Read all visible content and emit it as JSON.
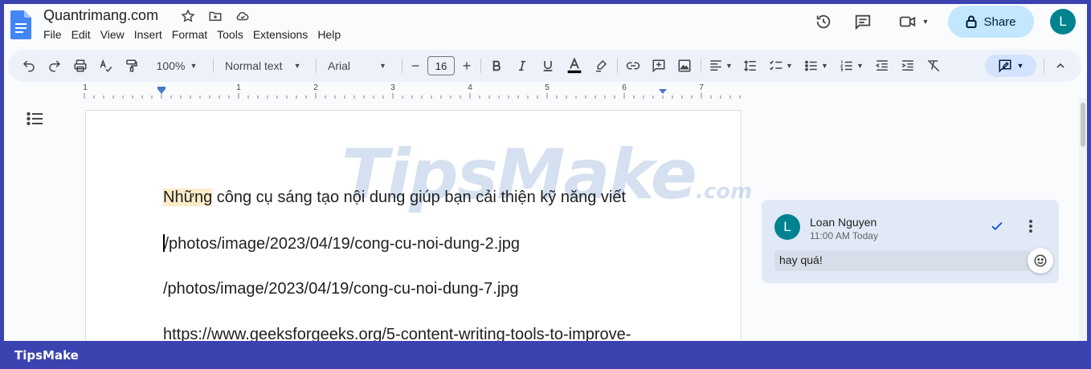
{
  "app": {
    "doc_title": "Quantrimang.com",
    "menu": [
      "File",
      "Edit",
      "View",
      "Insert",
      "Format",
      "Tools",
      "Extensions",
      "Help"
    ],
    "share_label": "Share",
    "user_initial": "L"
  },
  "toolbar": {
    "zoom": "100%",
    "style": "Normal text",
    "font": "Arial",
    "font_size": "16",
    "minus": "−",
    "plus": "+"
  },
  "ruler": {
    "numbers": [
      "1",
      "1",
      "2",
      "3",
      "4",
      "5",
      "6",
      "7"
    ]
  },
  "document": {
    "lines": [
      {
        "highlight": "Những",
        "rest": " công cụ sáng tạo nội dung giúp bạn cải thiện kỹ năng viết"
      },
      {
        "text": "/photos/image/2023/04/19/cong-cu-noi-dung-2.jpg"
      },
      {
        "text": "/photos/image/2023/04/19/cong-cu-noi-dung-7.jpg"
      },
      {
        "text": "https://www.geeksforgeeks.org/5-content-writing-tools-to-improve-"
      }
    ]
  },
  "watermark": {
    "main": "TipsMake",
    "suffix": ".com"
  },
  "comment": {
    "author_initial": "L",
    "author": "Loan Nguyen",
    "time": "11:00 AM Today",
    "reply_text": "hay quá!"
  },
  "brand": "TipsMake",
  "colors": {
    "frame": "#3b43b0",
    "accent": "#0b57d0",
    "avatar": "#00838f",
    "share_bg": "#c2e7ff",
    "highlight": "#fdecc8"
  },
  "icons": [
    "docs-icon",
    "star-icon",
    "folder-icon",
    "cloud-icon",
    "history-icon",
    "comment-icon",
    "video-icon",
    "lock-icon",
    "undo-icon",
    "redo-icon",
    "print-icon",
    "spellcheck-icon",
    "paint-format-icon",
    "bold-icon",
    "italic-icon",
    "underline-icon",
    "text-color-icon",
    "highlight-icon",
    "link-icon",
    "add-comment-icon",
    "image-icon",
    "align-icon",
    "line-spacing-icon",
    "checklist-icon",
    "bullet-list-icon",
    "numbered-list-icon",
    "indent-decrease-icon",
    "indent-increase-icon",
    "clear-format-icon",
    "editing-mode-icon",
    "chevron-up-icon",
    "outline-icon",
    "check-icon",
    "more-vert-icon",
    "emoji-icon"
  ]
}
